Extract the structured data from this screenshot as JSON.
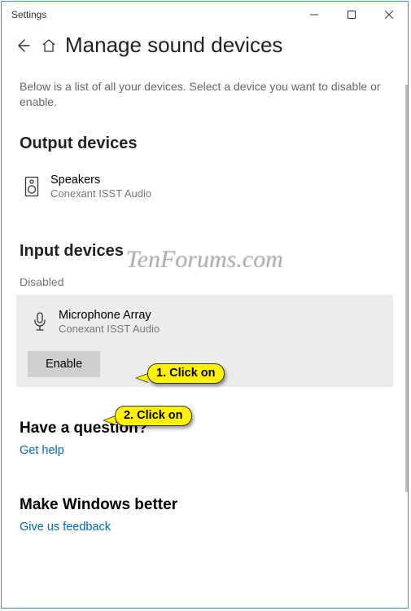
{
  "window_title": "Settings",
  "page_title": "Manage sound devices",
  "description": "Below is a list of all your devices. Select a device you want to disable or enable.",
  "output": {
    "heading": "Output devices",
    "device_name": "Speakers",
    "device_sub": "Conexant ISST Audio"
  },
  "input": {
    "heading": "Input devices",
    "disabled_label": "Disabled",
    "device_name": "Microphone Array",
    "device_sub": "Conexant ISST Audio",
    "enable_label": "Enable"
  },
  "question": {
    "heading": "Have a question?",
    "link": "Get help"
  },
  "feedback": {
    "heading": "Make Windows better",
    "link": "Give us feedback"
  },
  "callout1": "1. Click on",
  "callout2": "2. Click on",
  "watermark": "TenForums.com"
}
